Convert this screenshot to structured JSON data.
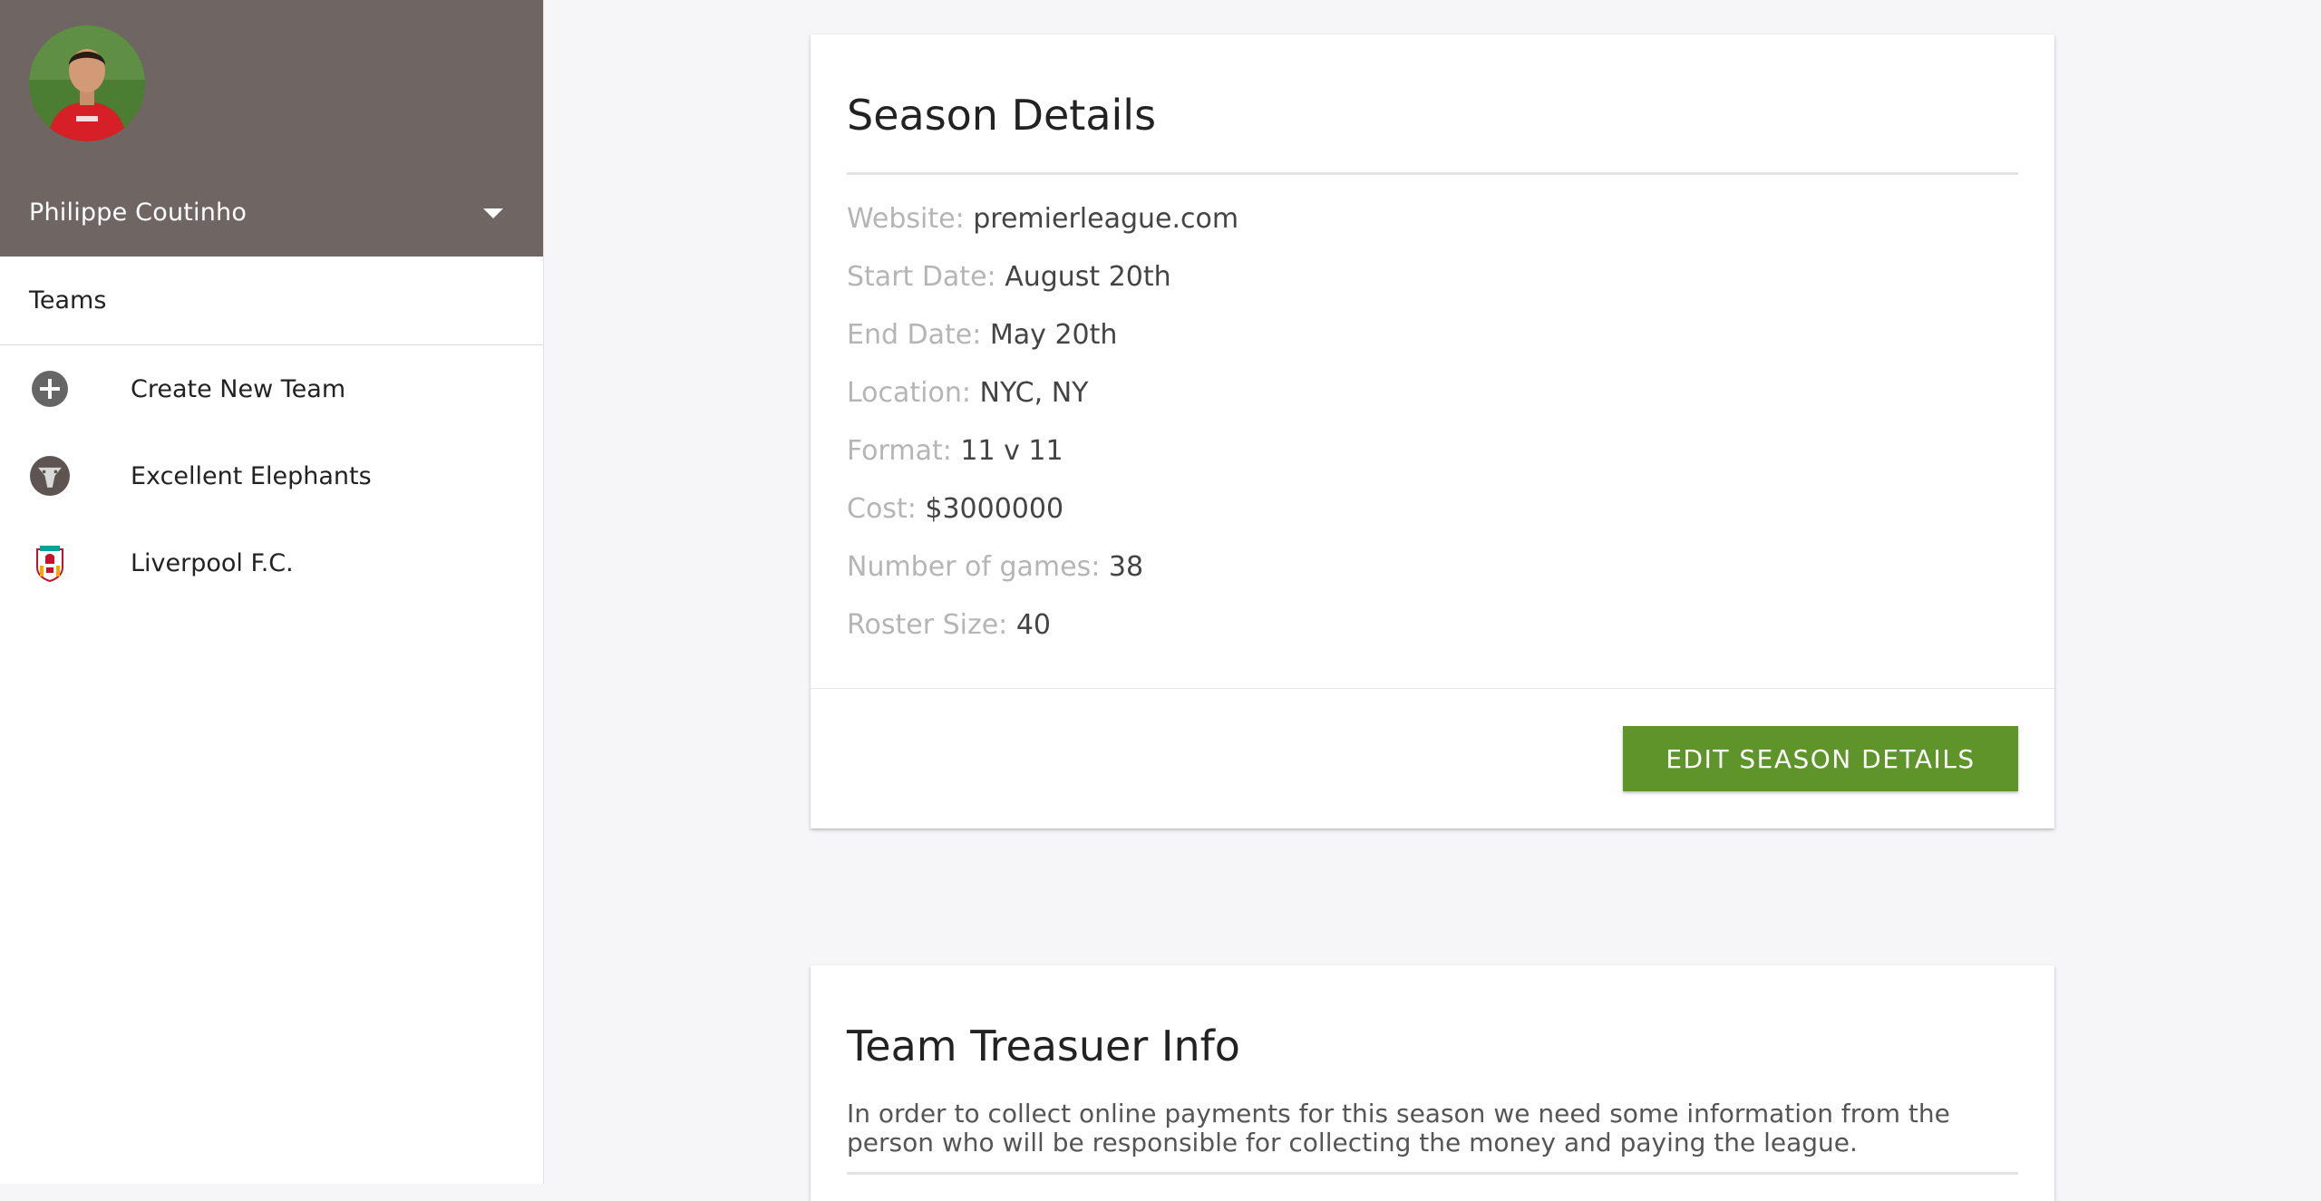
{
  "sidebar": {
    "profile": {
      "name": "Philippe Coutinho"
    },
    "section_header": "Teams",
    "items": [
      {
        "label": "Create New Team",
        "icon": "plus-circle-icon"
      },
      {
        "label": "Excellent Elephants",
        "icon": "elephant-logo-icon"
      },
      {
        "label": "Liverpool F.C.",
        "icon": "liverpool-crest-icon"
      }
    ]
  },
  "season_details": {
    "title": "Season Details",
    "fields": [
      {
        "label": "Website:",
        "value": "premierleague.com"
      },
      {
        "label": "Start Date:",
        "value": "August 20th"
      },
      {
        "label": "End Date:",
        "value": "May 20th"
      },
      {
        "label": "Location:",
        "value": "NYC, NY"
      },
      {
        "label": "Format:",
        "value": "11 v 11"
      },
      {
        "label": "Cost:",
        "value": "$3000000"
      },
      {
        "label": "Number of games:",
        "value": "38"
      },
      {
        "label": "Roster Size:",
        "value": "40"
      }
    ],
    "edit_button_label": "EDIT SEASON DETAILS"
  },
  "treasurer_info": {
    "title": "Team Treasuer Info",
    "description": "In order to collect online payments for this season we need some information from the person who will be responsible for collecting the money and paying the league."
  },
  "colors": {
    "sidebar_header_bg": "#6f6562",
    "button_green": "#5e9429",
    "page_bg": "#f6f5f7"
  }
}
